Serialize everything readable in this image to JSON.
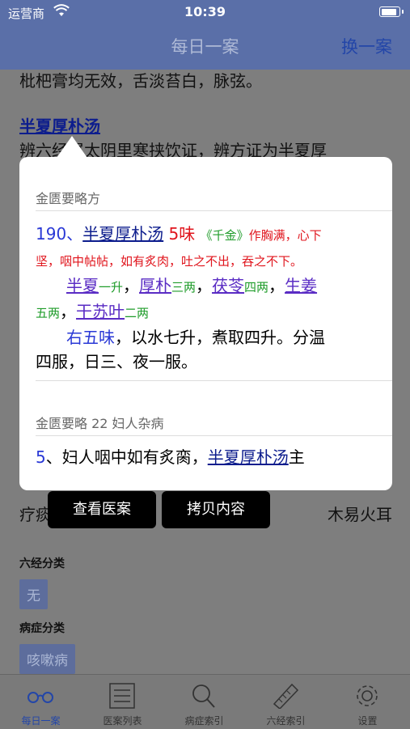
{
  "status_bar": {
    "carrier": "运营商",
    "time": "10:39",
    "battery_level": 0.9
  },
  "navbar": {
    "title": "每日一案",
    "right_button": "换一案"
  },
  "background": {
    "line1": "枇杷膏均无效，舌淡苔白，脉弦。",
    "formula_link": "半夏厚朴汤",
    "line3": "辨六经属太阴里寒挟饮证，辨方证为半夏厚",
    "line_bottom": "疗痰",
    "line_bottom_right": "木易火耳",
    "liujing_heading": "六经分类",
    "liujing_tag": "无",
    "bingzheng_heading": "病症分类",
    "bingzheng_tag": "咳嗽病"
  },
  "popup": {
    "section1_title": "金匮要略方",
    "entry_number": "190、",
    "entry_name": "半夏厚朴汤",
    "entry_count": "5味",
    "entry_source": "《千金》",
    "entry_desc_1": "作胸满，心下",
    "entry_desc_2": "坚，咽中帖帖，如有炙肉，吐之不出，吞之不下。",
    "herbs": [
      {
        "name": "半夏",
        "dose": "一升",
        "sep": "，"
      },
      {
        "name": "厚朴",
        "dose": "三两",
        "sep": "，"
      },
      {
        "name": "茯苓",
        "dose": "四两",
        "sep": "，"
      },
      {
        "name": "生姜",
        "dose": "",
        "sep": ""
      },
      {
        "name": "",
        "dose": "五两",
        "sep": "，"
      },
      {
        "name": "干苏叶",
        "dose": "二两",
        "sep": ""
      }
    ],
    "method_lead": "右五味",
    "method_text": "，以水七升，煮取四升。分温",
    "method_text_2": "四服，日三、夜一服。",
    "section2_title": "金匮要略 22  妇人杂病",
    "clause_number": "5",
    "clause_text": "、妇人咽中如有炙脔，",
    "clause_link": "半夏厚朴汤",
    "clause_tail": "主"
  },
  "buttons": {
    "view_case": "查看医案",
    "copy_content": "拷贝内容"
  },
  "tabbar": {
    "items": [
      {
        "label": "每日一案",
        "icon": "glasses-icon",
        "active": true
      },
      {
        "label": "医案列表",
        "icon": "list-icon",
        "active": false
      },
      {
        "label": "病症索引",
        "icon": "search-icon",
        "active": false
      },
      {
        "label": "六经索引",
        "icon": "ruler-icon",
        "active": false
      },
      {
        "label": "设置",
        "icon": "gear-icon",
        "active": false
      }
    ]
  },
  "colors": {
    "nav": "#5a6fa8",
    "accent": "#2346a8",
    "overlay": "#7e7e7e"
  }
}
